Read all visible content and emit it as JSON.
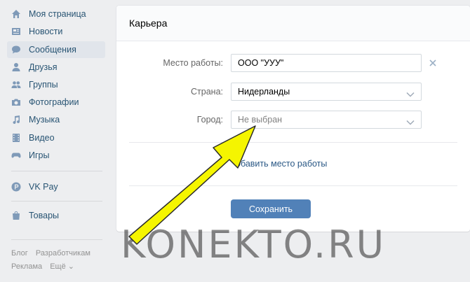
{
  "sidebar": {
    "items": [
      {
        "label": "Моя страница",
        "icon": "home-icon"
      },
      {
        "label": "Новости",
        "icon": "news-icon"
      },
      {
        "label": "Сообщения",
        "icon": "messages-icon"
      },
      {
        "label": "Друзья",
        "icon": "friend-icon"
      },
      {
        "label": "Группы",
        "icon": "groups-icon"
      },
      {
        "label": "Фотографии",
        "icon": "camera-icon"
      },
      {
        "label": "Музыка",
        "icon": "music-icon"
      },
      {
        "label": "Видео",
        "icon": "video-icon"
      },
      {
        "label": "Игры",
        "icon": "gamepad-icon"
      }
    ],
    "vkpay": {
      "label": "VK Pay",
      "icon": "vkpay-icon"
    },
    "goods": {
      "label": "Товары",
      "icon": "shopping-bag-icon"
    },
    "footer": {
      "blog": "Блог",
      "developers": "Разработчикам",
      "ads": "Реклама",
      "more": "Ещё ⌄"
    }
  },
  "card": {
    "title": "Карьера",
    "workplace": {
      "label": "Место работы:",
      "value": "ООО \"УУУ\""
    },
    "country": {
      "label": "Страна:",
      "value": "Нидерланды"
    },
    "city": {
      "label": "Город:",
      "placeholder": "Не выбран"
    },
    "add_workplace": "обавить место работы",
    "save": "Сохранить"
  },
  "watermark": "KONEKTO.RU",
  "colors": {
    "accent": "#5181b8",
    "link": "#2a5885",
    "arrow": "#f5f500"
  }
}
